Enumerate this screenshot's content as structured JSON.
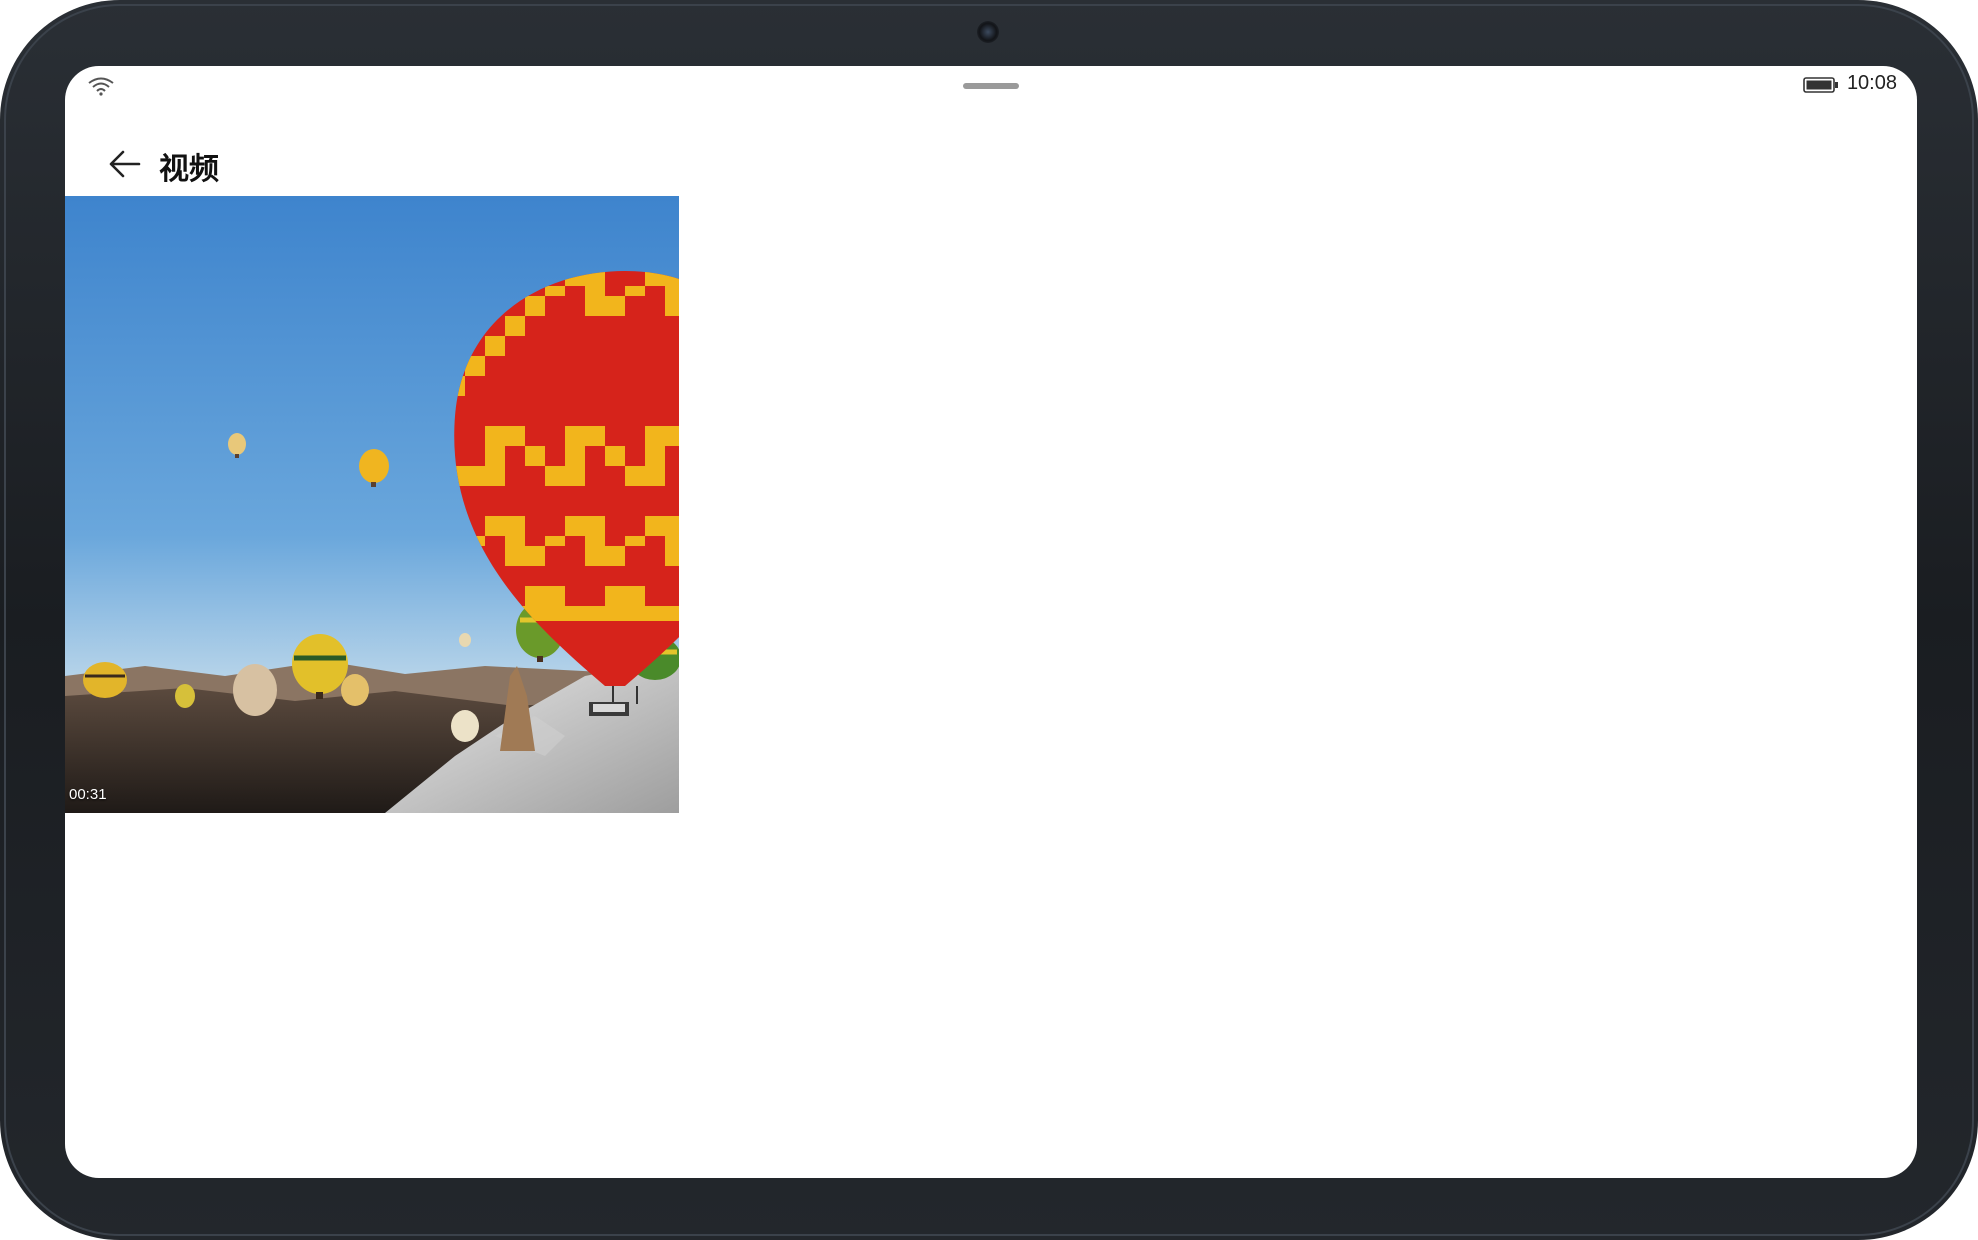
{
  "status_bar": {
    "time": "10:08",
    "wifi_icon": "wifi-icon",
    "battery_icon": "battery-icon"
  },
  "header": {
    "back_icon": "back-arrow-icon",
    "title": "视频"
  },
  "videos": [
    {
      "thumbnail": "hot-air-balloons",
      "duration": "00:31"
    }
  ],
  "colors": {
    "sky_top": "#3f86cf",
    "sky_bottom": "#b9d8ee",
    "balloon_red": "#d6231b",
    "balloon_yellow": "#f2b51c"
  }
}
